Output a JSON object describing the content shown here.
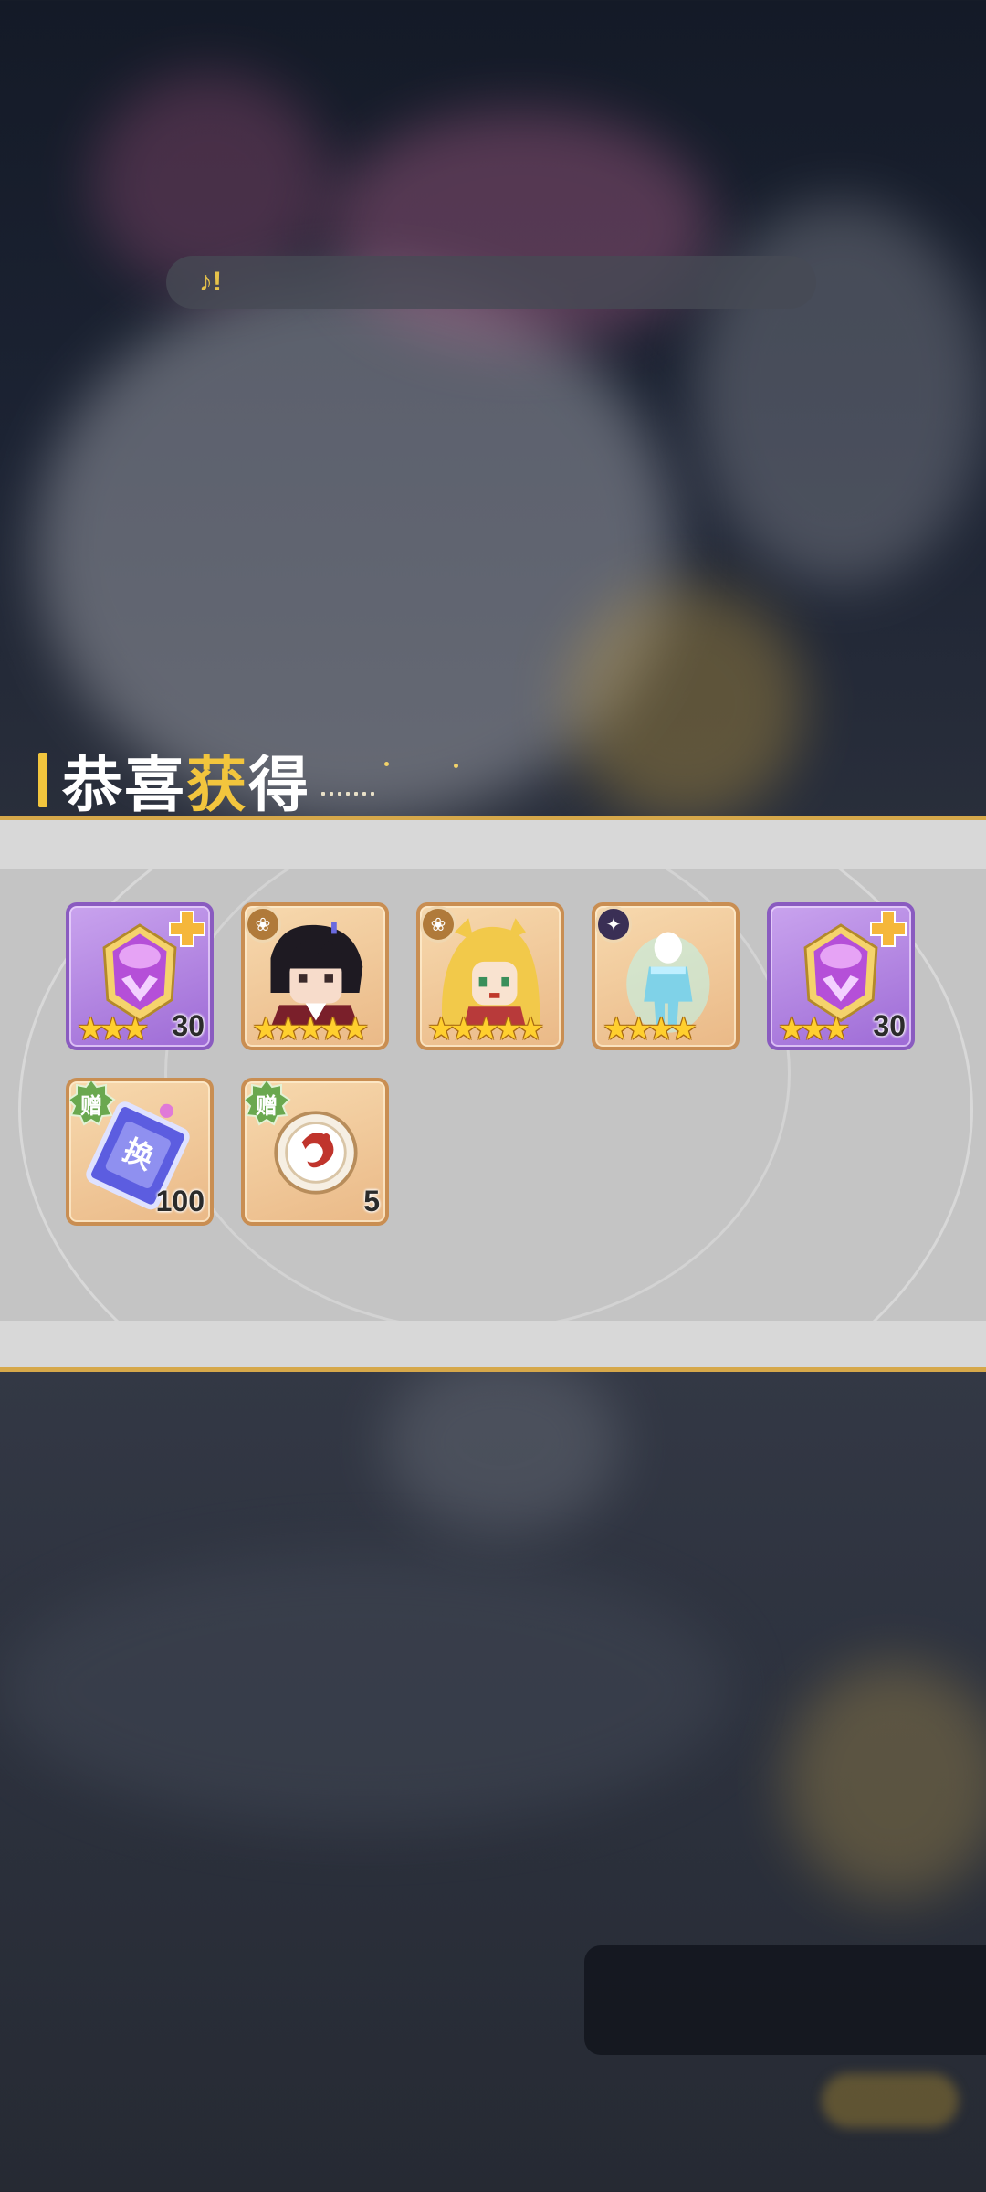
{
  "toast": {
    "text": "♪!"
  },
  "title": {
    "part1": "恭喜",
    "highlight": "获",
    "part2": "得"
  },
  "colors": {
    "gold": "#f2c53d",
    "band": "#c4c4c4",
    "card": "#eab987",
    "purple_card": "#9e6bd6"
  },
  "rewards": [
    {
      "name": "purple helmet equipment",
      "icon": "helmet-icon",
      "stars": "★★★",
      "count": "30",
      "rarity": "purple"
    },
    {
      "name": "dark-haired hero",
      "icon": "hero-portrait-icon",
      "stars": "★★★★★",
      "count": ""
    },
    {
      "name": "blonde heroine",
      "icon": "heroine-portrait-icon",
      "stars": "★★★★★",
      "count": ""
    },
    {
      "name": "blue spirit figure",
      "icon": "spirit-figure-icon",
      "stars": "★★★★",
      "count": ""
    },
    {
      "name": "purple helmet equipment",
      "icon": "helmet-icon",
      "stars": "★★★",
      "count": "30",
      "rarity": "purple"
    },
    {
      "name": "exchange ticket",
      "icon": "exchange-ticket-icon",
      "gift": "赠",
      "ticket_char": "换",
      "count": "100"
    },
    {
      "name": "dragon token",
      "icon": "dragon-token-icon",
      "gift": "赠",
      "count": "5"
    }
  ]
}
